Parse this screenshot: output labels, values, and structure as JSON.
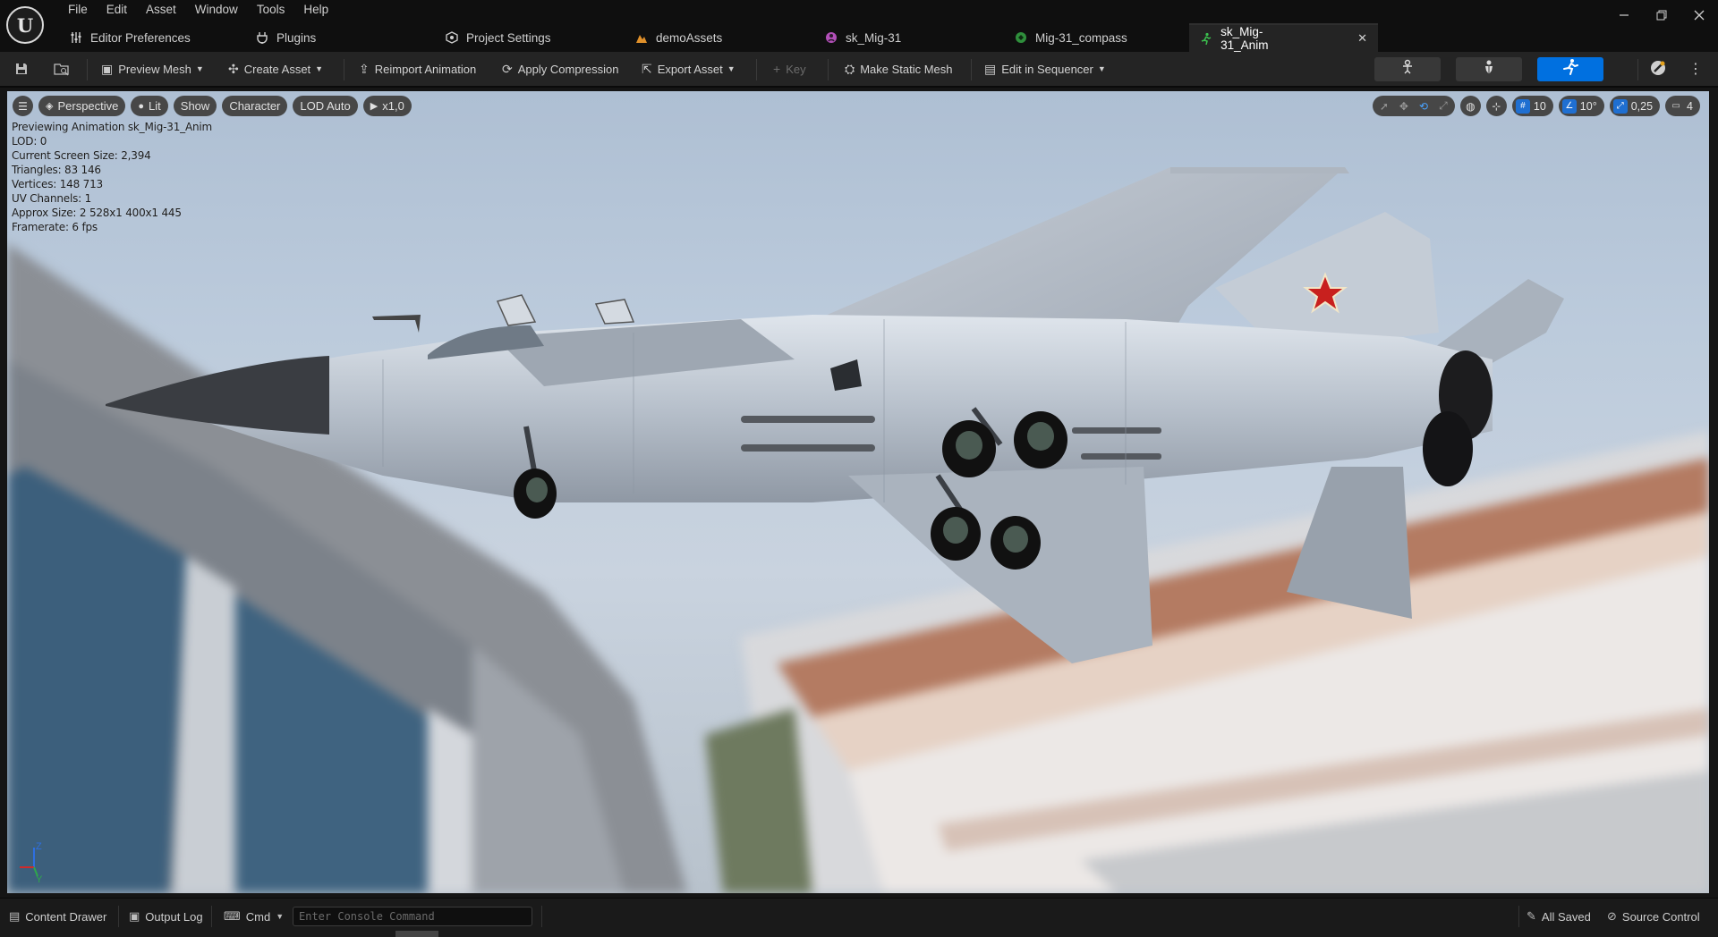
{
  "menubar": {
    "items": [
      "File",
      "Edit",
      "Asset",
      "Window",
      "Tools",
      "Help"
    ]
  },
  "tabs": [
    {
      "label": "Editor Preferences",
      "icon": "sliders-icon"
    },
    {
      "label": "Plugins",
      "icon": "plug-icon"
    },
    {
      "label": "Project Settings",
      "icon": "settings-cube-icon"
    },
    {
      "label": "demoAssets",
      "icon": "level-icon"
    },
    {
      "label": "sk_Mig-31",
      "icon": "skeleton-icon"
    },
    {
      "label": "Mig-31_compass",
      "icon": "mesh-icon"
    },
    {
      "label": "sk_Mig-31_Anim",
      "icon": "animation-icon",
      "active": true
    }
  ],
  "toolbar": {
    "preview_mesh": "Preview Mesh",
    "create_asset": "Create Asset",
    "reimport_animation": "Reimport Animation",
    "apply_compression": "Apply Compression",
    "export_asset": "Export Asset",
    "key": "Key",
    "make_static_mesh": "Make Static Mesh",
    "edit_in_sequencer": "Edit in Sequencer"
  },
  "viewport": {
    "pills": {
      "perspective": "Perspective",
      "lit": "Lit",
      "show": "Show",
      "character": "Character",
      "lod": "LOD Auto",
      "playback": "x1,0"
    },
    "snap": {
      "grid": "10",
      "rotation": "10°",
      "scale": "0,25",
      "camera_speed": "4"
    },
    "stats": [
      "Previewing Animation sk_Mig-31_Anim",
      "LOD: 0",
      "Current Screen Size: 2,394",
      "Triangles: 83 146",
      "Vertices: 148 713",
      "UV Channels: 1",
      "Approx Size: 2 528x1 400x1 445",
      "Framerate: 6 fps"
    ],
    "axis": {
      "z": "Z",
      "y": "Y"
    }
  },
  "statusbar": {
    "content_drawer": "Content Drawer",
    "output_log": "Output Log",
    "cmd": "Cmd",
    "console_placeholder": "Enter Console Command",
    "all_saved": "All Saved",
    "source_control": "Source Control"
  },
  "colors": {
    "accent": "#0070e0",
    "roundel_red": "#c8201e"
  }
}
